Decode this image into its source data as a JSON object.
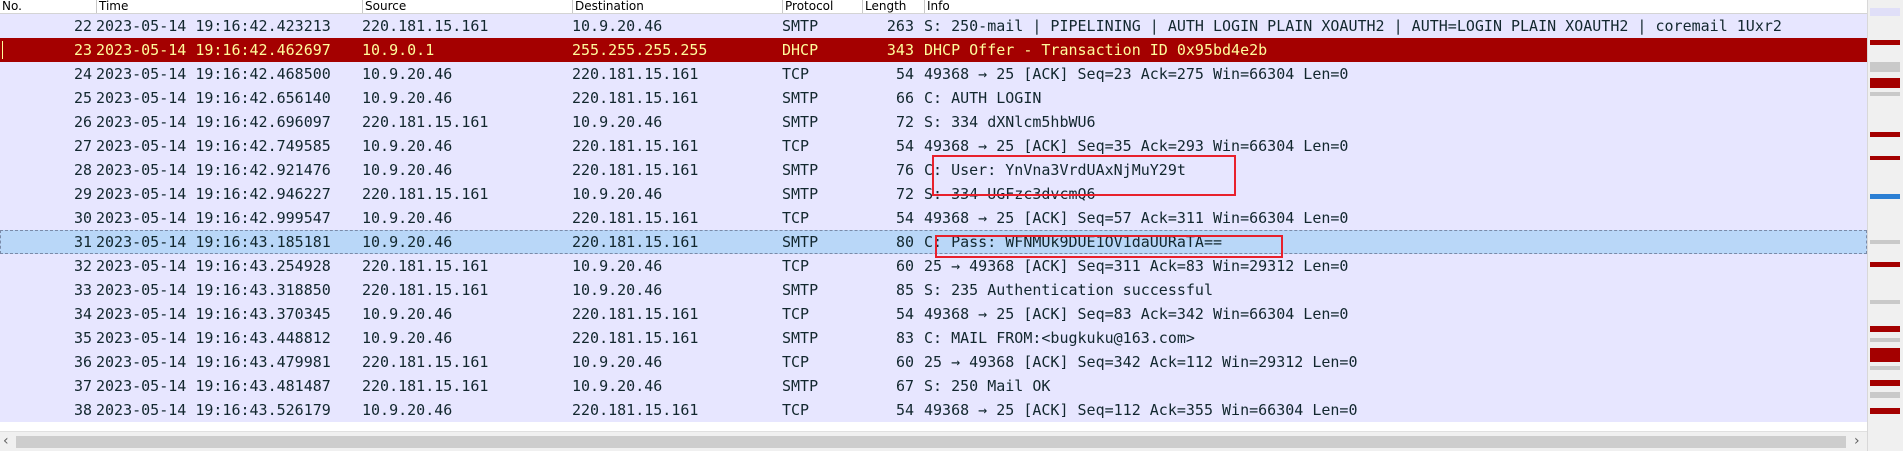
{
  "columns": {
    "no": "No.",
    "time": "Time",
    "source": "Source",
    "destination": "Destination",
    "protocol": "Protocol",
    "length": "Length",
    "info": "Info"
  },
  "packets": [
    {
      "no": "22",
      "time": "2023-05-14 19:16:42.423213",
      "source": "220.181.15.161",
      "destination": "10.9.20.46",
      "protocol": "SMTP",
      "length": "263",
      "info": "S: 250-mail | PIPELINING | AUTH LOGIN PLAIN XOAUTH2 | AUTH=LOGIN PLAIN XOAUTH2 | coremail 1Uxr2"
    },
    {
      "no": "23",
      "time": "2023-05-14 19:16:42.462697",
      "source": "10.9.0.1",
      "destination": "255.255.255.255",
      "protocol": "DHCP",
      "length": "343",
      "info": "DHCP Offer    - Transaction ID 0x95bd4e2b",
      "style": "dhcp"
    },
    {
      "no": "24",
      "time": "2023-05-14 19:16:42.468500",
      "source": "10.9.20.46",
      "destination": "220.181.15.161",
      "protocol": "TCP",
      "length": "54",
      "info": "49368 → 25 [ACK] Seq=23 Ack=275 Win=66304 Len=0"
    },
    {
      "no": "25",
      "time": "2023-05-14 19:16:42.656140",
      "source": "10.9.20.46",
      "destination": "220.181.15.161",
      "protocol": "SMTP",
      "length": "66",
      "info": "C: AUTH LOGIN"
    },
    {
      "no": "26",
      "time": "2023-05-14 19:16:42.696097",
      "source": "220.181.15.161",
      "destination": "10.9.20.46",
      "protocol": "SMTP",
      "length": "72",
      "info": "S: 334 dXNlcm5hbWU6"
    },
    {
      "no": "27",
      "time": "2023-05-14 19:16:42.749585",
      "source": "10.9.20.46",
      "destination": "220.181.15.161",
      "protocol": "TCP",
      "length": "54",
      "info": "49368 → 25 [ACK] Seq=35 Ack=293 Win=66304 Len=0"
    },
    {
      "no": "28",
      "time": "2023-05-14 19:16:42.921476",
      "source": "10.9.20.46",
      "destination": "220.181.15.161",
      "protocol": "SMTP",
      "length": "76",
      "info": "C: User: YnVna3VrdUAxNjMuY29t"
    },
    {
      "no": "29",
      "time": "2023-05-14 19:16:42.946227",
      "source": "220.181.15.161",
      "destination": "10.9.20.46",
      "protocol": "SMTP",
      "length": "72",
      "info": "S: 334 UGFzc3dvcmQ6"
    },
    {
      "no": "30",
      "time": "2023-05-14 19:16:42.999547",
      "source": "10.9.20.46",
      "destination": "220.181.15.161",
      "protocol": "TCP",
      "length": "54",
      "info": "49368 → 25 [ACK] Seq=57 Ack=311 Win=66304 Len=0"
    },
    {
      "no": "31",
      "time": "2023-05-14 19:16:43.185181",
      "source": "10.9.20.46",
      "destination": "220.181.15.161",
      "protocol": "SMTP",
      "length": "80",
      "info": "C: Pass: WFNMUk9DUE1OV1daUURaTA==",
      "style": "selected"
    },
    {
      "no": "32",
      "time": "2023-05-14 19:16:43.254928",
      "source": "220.181.15.161",
      "destination": "10.9.20.46",
      "protocol": "TCP",
      "length": "60",
      "info": "25 → 49368 [ACK] Seq=311 Ack=83 Win=29312 Len=0"
    },
    {
      "no": "33",
      "time": "2023-05-14 19:16:43.318850",
      "source": "220.181.15.161",
      "destination": "10.9.20.46",
      "protocol": "SMTP",
      "length": "85",
      "info": "S: 235 Authentication successful"
    },
    {
      "no": "34",
      "time": "2023-05-14 19:16:43.370345",
      "source": "10.9.20.46",
      "destination": "220.181.15.161",
      "protocol": "TCP",
      "length": "54",
      "info": "49368 → 25 [ACK] Seq=83 Ack=342 Win=66304 Len=0"
    },
    {
      "no": "35",
      "time": "2023-05-14 19:16:43.448812",
      "source": "10.9.20.46",
      "destination": "220.181.15.161",
      "protocol": "SMTP",
      "length": "83",
      "info": "C: MAIL FROM:<bugkuku@163.com>"
    },
    {
      "no": "36",
      "time": "2023-05-14 19:16:43.479981",
      "source": "220.181.15.161",
      "destination": "10.9.20.46",
      "protocol": "TCP",
      "length": "60",
      "info": "25 → 49368 [ACK] Seq=342 Ack=112 Win=29312 Len=0"
    },
    {
      "no": "37",
      "time": "2023-05-14 19:16:43.481487",
      "source": "220.181.15.161",
      "destination": "10.9.20.46",
      "protocol": "SMTP",
      "length": "67",
      "info": "S: 250 Mail OK"
    },
    {
      "no": "38",
      "time": "2023-05-14 19:16:43.526179",
      "source": "10.9.20.46",
      "destination": "220.181.15.161",
      "protocol": "TCP",
      "length": "54",
      "info": "49368 → 25 [ACK] Seq=112 Ack=355 Win=66304 Len=0"
    }
  ],
  "colors": {
    "row_bg": "#e7e6ff",
    "row_fg": "#12272e",
    "dhcp_bg": "#a40000",
    "dhcp_fg": "#fffc9c",
    "selected_bg": "#b9d7f8",
    "annotation": "#e8212c"
  },
  "scrollbar": {
    "left_arrow": "‹",
    "right_arrow": "›"
  }
}
